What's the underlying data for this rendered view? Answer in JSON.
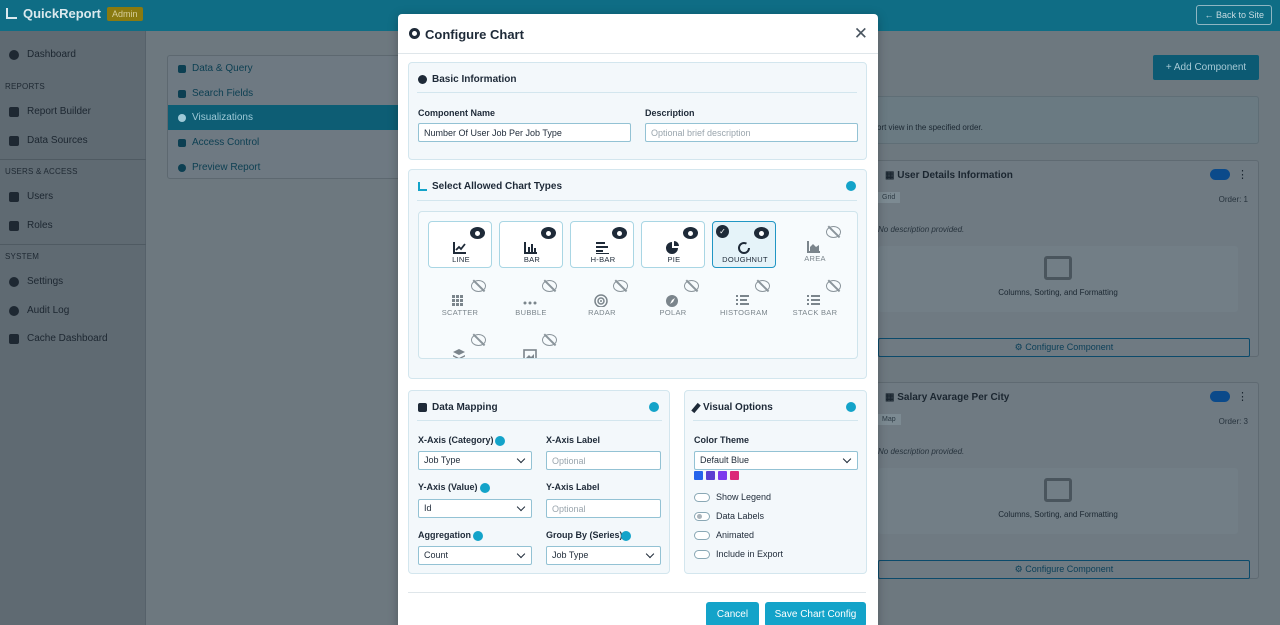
{
  "app": {
    "brand": "QuickReport",
    "role_badge": "Admin",
    "back_link": "Back to Site"
  },
  "sidebar": {
    "items_top": [
      {
        "label": "Dashboard"
      }
    ],
    "reports_heading": "REPORTS",
    "reports": [
      {
        "label": "Report Builder"
      },
      {
        "label": "Data Sources"
      }
    ],
    "users_heading": "USERS & ACCESS",
    "users": [
      {
        "label": "Users"
      },
      {
        "label": "Roles"
      }
    ],
    "system_heading": "SYSTEM",
    "system": [
      {
        "label": "Settings"
      },
      {
        "label": "Audit Log"
      },
      {
        "label": "Cache Dashboard"
      }
    ]
  },
  "builder": {
    "tabs": [
      {
        "label": "Data & Query"
      },
      {
        "label": "Search Fields"
      },
      {
        "label": "Visualizations"
      },
      {
        "label": "Access Control"
      },
      {
        "label": "Preview Report"
      }
    ],
    "add_component": "Add Component",
    "info_text": "ort view in the specified order.",
    "cards": [
      {
        "title": "User Details Information",
        "tag": "Grid",
        "order": "Order: 1",
        "desc": "No description provided.",
        "grid_text": "Columns, Sorting, and Formatting",
        "cfg": "Configure Component"
      },
      {
        "title": "Salary Avarage Per City",
        "tag": "Map",
        "order": "Order: 3",
        "desc": "No description provided.",
        "grid_text": "Columns, Sorting, and Formatting",
        "cfg": "Configure Component"
      }
    ]
  },
  "modal": {
    "title": "Configure Chart",
    "basic": {
      "title": "Basic Information",
      "component_name_label": "Component Name",
      "component_name_value": "Number Of User Job Per Job Type",
      "description_label": "Description",
      "description_placeholder": "Optional brief description"
    },
    "chart_types": {
      "title": "Select Allowed Chart Types",
      "row1": [
        {
          "label": "LINE",
          "icon": "line-chart-icon",
          "state": "on"
        },
        {
          "label": "BAR",
          "icon": "bar-chart-icon",
          "state": "on"
        },
        {
          "label": "H-BAR",
          "icon": "hbar-chart-icon",
          "state": "on"
        },
        {
          "label": "PIE",
          "icon": "pie-chart-icon",
          "state": "on"
        },
        {
          "label": "DOUGHNUT",
          "icon": "doughnut-chart-icon",
          "state": "selected"
        },
        {
          "label": "AREA",
          "icon": "area-chart-icon",
          "state": "off"
        }
      ],
      "row2": [
        {
          "label": "SCATTER",
          "icon": "scatter-chart-icon",
          "state": "off"
        },
        {
          "label": "BUBBLE",
          "icon": "bubble-chart-icon",
          "state": "off"
        },
        {
          "label": "RADAR",
          "icon": "radar-chart-icon",
          "state": "off"
        },
        {
          "label": "POLAR",
          "icon": "polar-chart-icon",
          "state": "off"
        },
        {
          "label": "HISTOGRAM",
          "icon": "histogram-chart-icon",
          "state": "off"
        },
        {
          "label": "STACK BAR",
          "icon": "stack-bar-chart-icon",
          "state": "off"
        }
      ],
      "row3": [
        {
          "label": "",
          "icon": "layers-chart-icon",
          "state": "off"
        },
        {
          "label": "",
          "icon": "image-chart-icon",
          "state": "off"
        }
      ]
    },
    "mapping": {
      "title": "Data Mapping",
      "x_axis_label": "X-Axis (Category)",
      "x_axis_value": "Job Type",
      "x_label_label": "X-Axis Label",
      "x_label_placeholder": "Optional",
      "y_axis_label": "Y-Axis (Value)",
      "y_axis_value": "Id",
      "y_label_label": "Y-Axis Label",
      "y_label_placeholder": "Optional",
      "aggregation_label": "Aggregation",
      "aggregation_value": "Count",
      "group_by_label": "Group By (Series)",
      "group_by_value": "Job Type"
    },
    "visual": {
      "title": "Visual Options",
      "color_theme_label": "Color Theme",
      "color_theme_value": "Default Blue",
      "swatch_colors": [
        "#2563eb",
        "#5b3fd1",
        "#7c3aed",
        "#db2777"
      ],
      "toggles": [
        {
          "label": "Show Legend",
          "on": false
        },
        {
          "label": "Data Labels",
          "on": true
        },
        {
          "label": "Animated",
          "on": false
        },
        {
          "label": "Include in Export",
          "on": false
        }
      ]
    },
    "cancel": "Cancel",
    "save": "Save Chart Config"
  }
}
